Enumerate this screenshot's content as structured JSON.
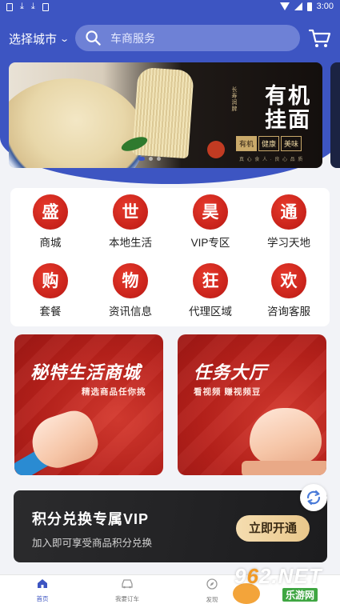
{
  "status_bar": {
    "time": "3:00"
  },
  "header": {
    "city_label": "选择城市",
    "search_placeholder": "车商服务"
  },
  "banner": {
    "title_line1": "有机",
    "title_line2": "挂面",
    "side_text": "长寿润脾",
    "tags": [
      "有机",
      "健康",
      "美味"
    ],
    "footer_text": "真 心 食 人 · 良 心 品 质",
    "slide_count": 3,
    "active_slide": 0
  },
  "menu": [
    {
      "icon_char": "盛",
      "label": "商城"
    },
    {
      "icon_char": "世",
      "label": "本地生活"
    },
    {
      "icon_char": "昊",
      "label": "VIP专区"
    },
    {
      "icon_char": "通",
      "label": "学习天地"
    },
    {
      "icon_char": "购",
      "label": "套餐"
    },
    {
      "icon_char": "物",
      "label": "资讯信息"
    },
    {
      "icon_char": "狂",
      "label": "代理区域"
    },
    {
      "icon_char": "欢",
      "label": "咨询客服"
    }
  ],
  "promos": [
    {
      "title": "秘特生活商城",
      "subtitle": "精选商品任你挑"
    },
    {
      "title": "任务大厅",
      "subtitle": "看视频 赚视频豆"
    }
  ],
  "vip": {
    "title": "积分兑换专属VIP",
    "subtitle": "加入即可享受商品积分兑换",
    "button": "立即开通"
  },
  "tabs": [
    {
      "label": "首页",
      "icon": "home-icon",
      "active": true
    },
    {
      "label": "我要订车",
      "icon": "car-icon",
      "active": false
    },
    {
      "label": "发现",
      "icon": "compass-icon",
      "active": false
    }
  ],
  "watermark": {
    "main_pre": "9",
    "main_o": "6",
    "main_post": "2.NET",
    "sub": "乐游网"
  },
  "colors": {
    "primary": "#3d55c2",
    "promo_red": "#c8221a",
    "vip_gold": "#e9c78b"
  }
}
